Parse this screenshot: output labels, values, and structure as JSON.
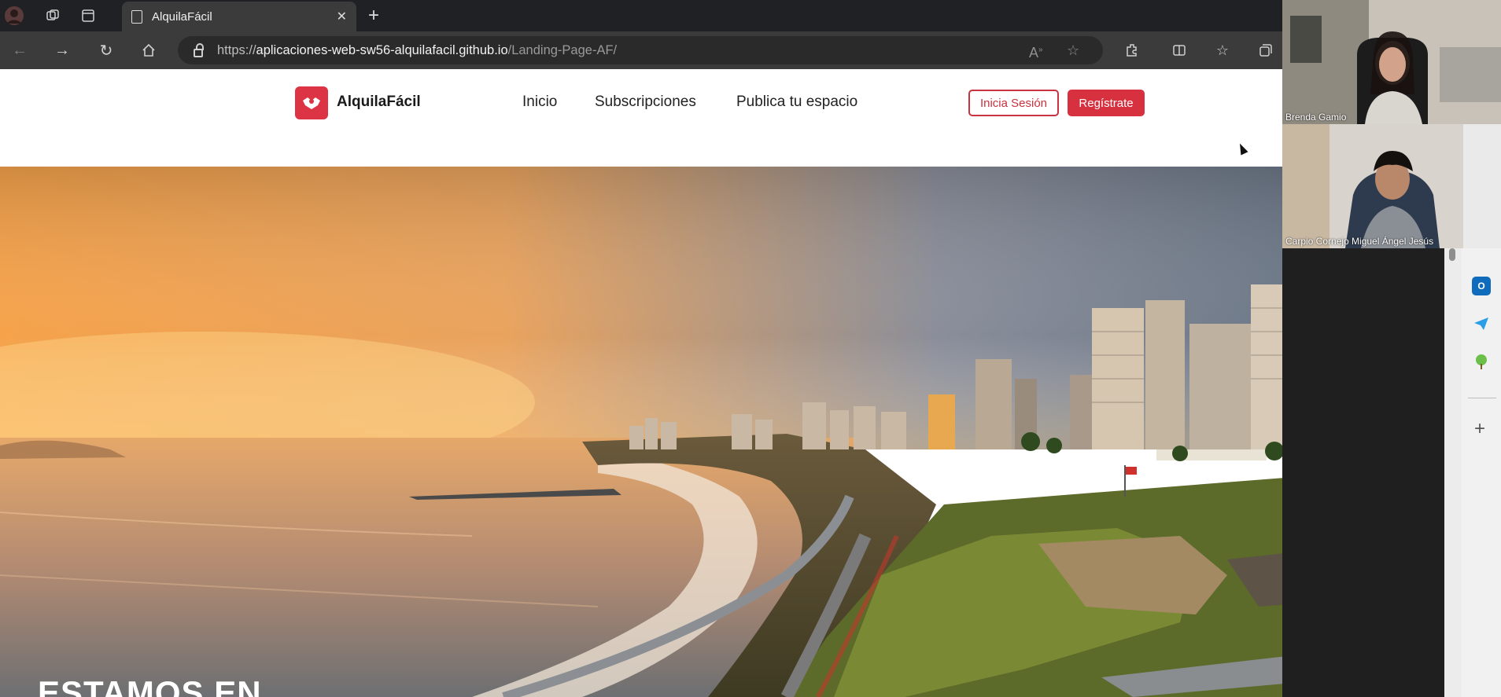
{
  "browser": {
    "tab_title": "AlquilaFácil",
    "url_prefix": "https://",
    "url_host": "aplicaciones-web-sw56-alquilafacil.github.io",
    "url_path": "/Landing-Page-AF/"
  },
  "site": {
    "brand": "AlquilaFácil",
    "nav": [
      "Inicio",
      "Subscripciones",
      "Publica tu espacio"
    ],
    "login_label": "Inicia Sesión",
    "register_label": "Regístrate",
    "hero_heading": "ESTAMOS EN"
  },
  "call": {
    "participants": [
      {
        "name": "Brenda Gamio"
      },
      {
        "name": "Carpio Cornejo Miguel Ángel Jesús"
      }
    ]
  },
  "colors": {
    "brand_red": "#dc3444",
    "chrome_dark": "#202124",
    "chrome_mid": "#3b3b3b"
  },
  "icons": {
    "side_outlook": "outlook-icon",
    "side_telegram": "send-icon",
    "side_tree": "tree-icon"
  }
}
